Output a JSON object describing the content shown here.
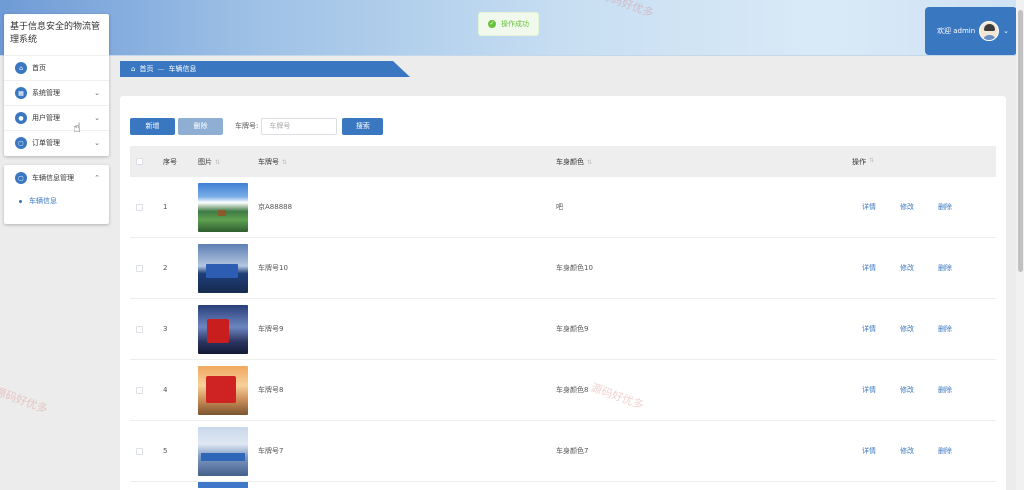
{
  "app": {
    "title": "基于信息安全的物流管理系统"
  },
  "toast": {
    "message": "操作成功"
  },
  "user": {
    "greeting": "欢迎 admin"
  },
  "sidebar": {
    "items": [
      {
        "label": "首页",
        "icon": "home-icon"
      },
      {
        "label": "系统管理",
        "icon": "system-icon"
      },
      {
        "label": "用户管理",
        "icon": "user-icon"
      },
      {
        "label": "订单管理",
        "icon": "order-icon"
      }
    ],
    "group": {
      "label": "车辆信息管理",
      "icon": "vehicle-icon"
    },
    "sub_items": [
      {
        "label": "车辆信息"
      }
    ]
  },
  "breadcrumb": {
    "home": "首页",
    "current": "车辆信息"
  },
  "toolbar": {
    "add_label": "新增",
    "delete_label": "删除",
    "search_label": "车牌号:",
    "search_placeholder": "车牌号",
    "search_button": "搜索"
  },
  "table": {
    "headers": {
      "index": "序号",
      "photo": "图片",
      "plate": "车牌号",
      "color": "车身颜色",
      "ops": "操作"
    },
    "ops": {
      "detail": "详情",
      "edit": "修改",
      "delete": "删除"
    },
    "rows": [
      {
        "index": "1",
        "plate": "京A88888",
        "color": "吧"
      },
      {
        "index": "2",
        "plate": "车牌号10",
        "color": "车身颜色10"
      },
      {
        "index": "3",
        "plate": "车牌号9",
        "color": "车身颜色9"
      },
      {
        "index": "4",
        "plate": "车牌号8",
        "color": "车身颜色8"
      },
      {
        "index": "5",
        "plate": "车牌号7",
        "color": "车身颜色7"
      }
    ]
  },
  "watermark": "源码好优多",
  "colors": {
    "primary": "#3a77c1",
    "success": "#67c23a"
  }
}
